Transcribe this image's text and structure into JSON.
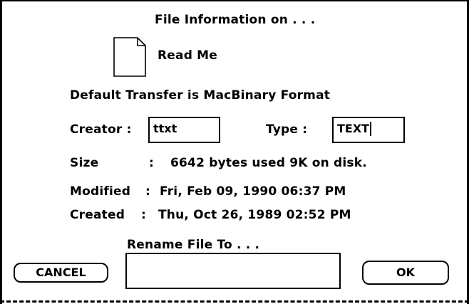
{
  "dialog": {
    "title": "File Information on . . .",
    "file_name": "Read Me",
    "transfer_note": "Default Transfer is MacBinary Format",
    "creator": {
      "label": "Creator :",
      "value": "ttxt"
    },
    "type": {
      "label": "Type :",
      "value": "TEXT"
    },
    "size": {
      "label": "Size",
      "colon": ":",
      "value": "6642 bytes used 9K on disk."
    },
    "modified": {
      "label": "Modified",
      "colon": ":",
      "value": "Fri, Feb 09, 1990  06:37 PM"
    },
    "created": {
      "label": "Created",
      "colon": ":",
      "value": "Thu, Oct 26, 1989  02:52 PM"
    },
    "rename": {
      "label": "Rename File To . . .",
      "value": ""
    },
    "buttons": {
      "cancel": "CANCEL",
      "ok": "OK"
    }
  },
  "icons": {
    "file": "document-icon"
  },
  "colors": {
    "foreground": "#000000",
    "background": "#ffffff"
  }
}
